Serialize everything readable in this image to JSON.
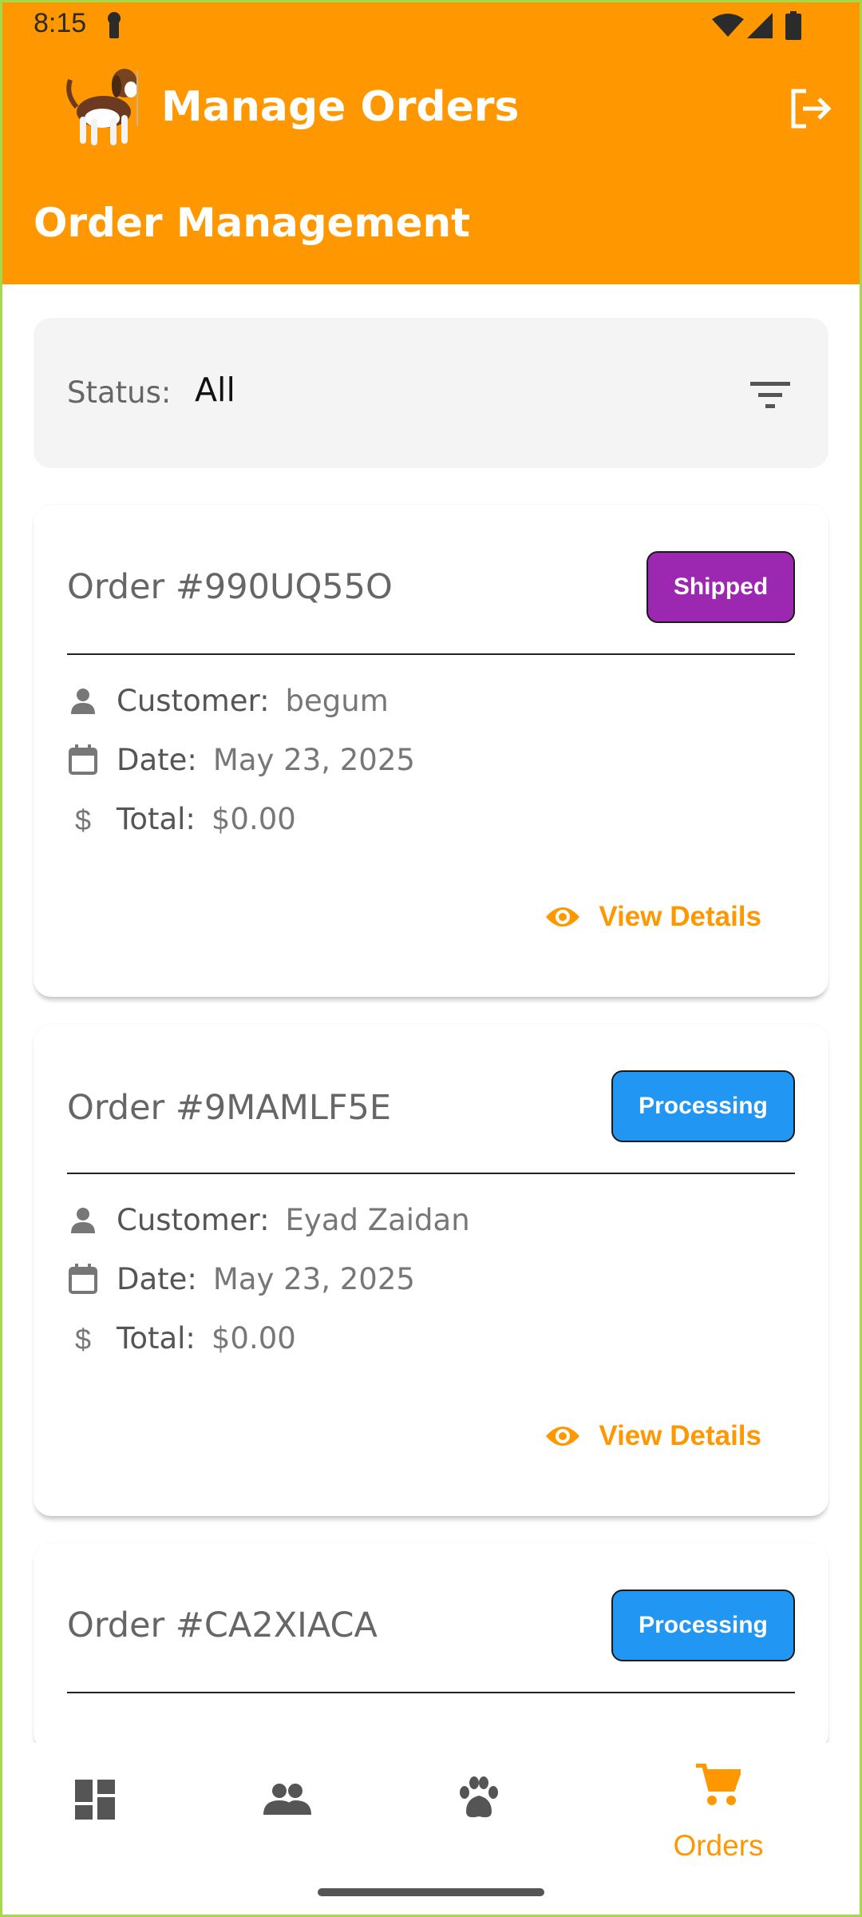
{
  "status_bar": {
    "time": "8:15"
  },
  "header": {
    "app_title": "Manage Orders",
    "page_title": "Order Management"
  },
  "filter": {
    "label": "Status:",
    "value": "All"
  },
  "labels": {
    "customer": "Customer:",
    "date": "Date:",
    "total": "Total:",
    "view_details": "View Details"
  },
  "orders": [
    {
      "id": "Order #990UQ55O",
      "status": "Shipped",
      "status_color": "#9c27b0",
      "customer": "begum",
      "date": "May 23, 2025",
      "total": "$0.00"
    },
    {
      "id": "Order #9MAMLF5E",
      "status": "Processing",
      "status_color": "#2196f3",
      "customer": "Eyad Zaidan",
      "date": "May 23, 2025",
      "total": "$0.00"
    },
    {
      "id": "Order #CA2XIACA",
      "status": "Processing",
      "status_color": "#2196f3"
    }
  ],
  "bottom_nav": {
    "items": [
      {
        "icon": "dashboard-icon"
      },
      {
        "icon": "people-icon"
      },
      {
        "icon": "paw-icon"
      },
      {
        "icon": "cart-icon",
        "label": "Orders",
        "active": true
      }
    ]
  },
  "colors": {
    "accent": "#ff9800",
    "shipped": "#9c27b0",
    "processing": "#2196f3"
  }
}
